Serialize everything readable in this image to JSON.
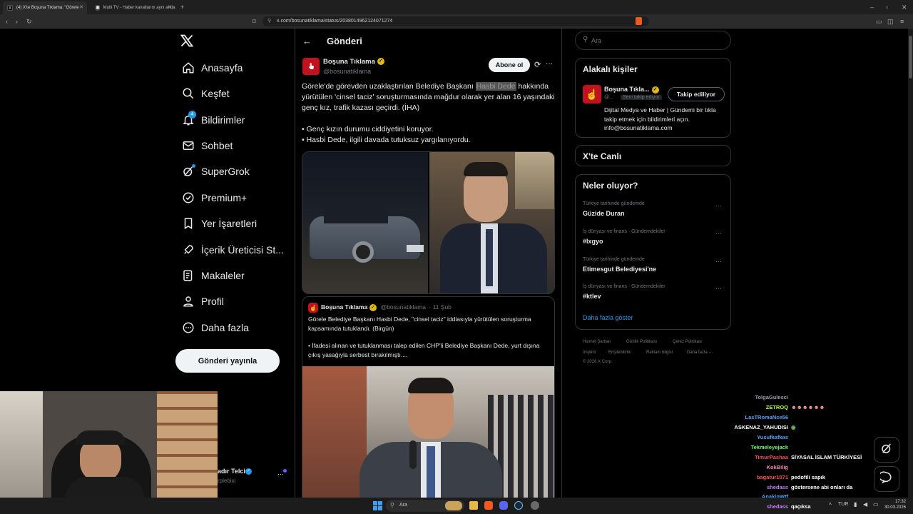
{
  "browser": {
    "tabs": [
      {
        "title": "(4) X'te Boşuna Tıklama: \"Görele",
        "active": true
      },
      {
        "title": "Multi TV - Haber kanallarını aynı anda",
        "active": false
      }
    ],
    "url": "x.com/bosunatiklama/status/2038014962124071274"
  },
  "nav": {
    "items": [
      {
        "label": "Anasayfa",
        "icon": "home-icon"
      },
      {
        "label": "Keşfet",
        "icon": "search-icon"
      },
      {
        "label": "Bildirimler",
        "icon": "bell-icon",
        "badge": "4"
      },
      {
        "label": "Sohbet",
        "icon": "mail-icon"
      },
      {
        "label": "SuperGrok",
        "icon": "grok-icon"
      },
      {
        "label": "Premium+",
        "icon": "premium-icon"
      },
      {
        "label": "Yer İşaretleri",
        "icon": "bookmark-icon"
      },
      {
        "label": "İçerik Üreticisi St...",
        "icon": "rocket-icon"
      },
      {
        "label": "Makaleler",
        "icon": "article-icon"
      },
      {
        "label": "Profil",
        "icon": "person-icon"
      },
      {
        "label": "Daha fazla",
        "icon": "more-icon"
      }
    ],
    "post_button": "Gönderi yayınla",
    "account_name": "adır Telci",
    "account_handle": "rplebixi"
  },
  "post": {
    "header_title": "Gönderi",
    "author_name": "Boşuna Tıklama",
    "author_handle": "@bosunatiklama",
    "subscribe_label": "Abone ol",
    "text_before": "Görele'de görevden uzaklaştırılan Belediye Başkanı ",
    "text_highlight": "Hasbi Dede",
    "text_after": " hakkında yürütülen 'cinsel taciz' soruşturmasında mağdur olarak yer alan 16 yaşındaki genç kız, trafik kazası geçirdi. (İHA)",
    "bullet1": "• Genç kızın durumu ciddiyetini koruyor.",
    "bullet2": "• Hasbi Dede, ilgili davada tutuksuz yargılanıyordu.",
    "quote": {
      "author_name": "Boşuna Tıklama",
      "author_handle": "@bosunatiklama",
      "date": "· 11 Şub",
      "text": "Görele Belediye Başkanı Hasbi Dede, \"cinsel taciz\" iddiasıyla yürütülen soruşturma kapsamında tutuklandı. (Birgün)",
      "bullet": "• İfadesi alınan ve tutuklanması talep edilen CHP'li Belediye Başkanı Dede, yurt dışına çıkış yasağıyla serbest bırakılmıştı...."
    }
  },
  "sidebar": {
    "search_placeholder": "Ara",
    "related_title": "Alakalı kişiler",
    "related_name": "Boşuna Tıkla...",
    "related_handle": "@...",
    "follows_you": "Seni takip ediyor",
    "following_label": "Takip ediliyor",
    "related_bio": "Dijital Medya ve Haber | Gündemi bir tıkla takip etmek için bildirimleri açın. info@bosunatiklama.com",
    "live_title": "X'te Canlı",
    "trends_title": "Neler oluyor?",
    "trends": [
      {
        "meta": "Türkiye tarihinde gündemde",
        "name": "Güzide Duran"
      },
      {
        "meta": "İş dünyası ve finans · Gündemdekiler",
        "name": "#lxgyo"
      },
      {
        "meta": "Türkiye tarihinde gündemde",
        "name": "Etimesgut Belediyesi'ne"
      },
      {
        "meta": "İş dünyası ve finans · Gündemdekiler",
        "name": "#ktlev"
      }
    ],
    "show_more": "Daha fazla göster",
    "footer": [
      "Hizmet Şartları",
      "Gizlilik Politikası",
      "Çerez Politikası",
      "Imprint",
      "Erişilebilirlik",
      "Reklam bilgisi",
      "Daha fazla ···"
    ],
    "copyright": "© 2026 X Corp."
  },
  "chat": [
    {
      "user": "TolgaGulesci",
      "msg": "",
      "color": "#9aa0a6"
    },
    {
      "user": "ZETROQ",
      "msg": "",
      "color": "#b7ff3c"
    },
    {
      "user": "LasTRomaNce56",
      "msg": "",
      "color": "#4da6ff"
    },
    {
      "user": "ASKENAZ_YAHUDISI",
      "msg": "",
      "color": "#ffffff"
    },
    {
      "user": "Yusufkafkas",
      "msg": "",
      "color": "#4da6ff"
    },
    {
      "user": "Tekmeleyejack",
      "msg": "",
      "color": "#6bff6b"
    },
    {
      "user": "TimurPashaa",
      "msg": "SİYASAL İSLAM TÜRKİYESİ",
      "color": "#ff4d4d"
    },
    {
      "user": "KokBilig",
      "msg": "",
      "color": "#ff7ab8"
    },
    {
      "user": "bagatur1071",
      "msg": "pedofili sapık",
      "color": "#ff4d4d"
    },
    {
      "user": "shedass",
      "msg": "göstersene abi onları da",
      "color": "#c77dff"
    },
    {
      "user": "AnakinWtf",
      "msg": "",
      "color": "#4da6ff"
    },
    {
      "user": "shedass",
      "msg": "qaçıksa",
      "color": "#c77dff"
    }
  ],
  "taskbar": {
    "search_placeholder": "Ara",
    "lang": "TUR",
    "time": "17:32",
    "date": "30.03.2026"
  }
}
